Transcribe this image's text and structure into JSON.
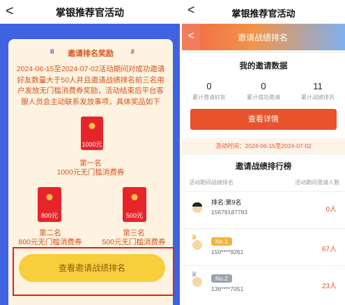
{
  "left": {
    "nav_back": "<",
    "title": "掌银推荐官活动",
    "section_title": "邀请排名奖励",
    "description": "2024-06-15至2024-07-02活动期间对成功邀请好友数量大于50人并且邀请战绩排名前三名用户发放无门槛消费券奖励，活动结束后平台客服人员会主动联系发放事项，具体奖品如下",
    "prizes": [
      {
        "amount": "1000元",
        "rank": "第一名",
        "desc": "1000元无门槛消费券"
      },
      {
        "amount": "800元",
        "rank": "第二名",
        "desc": "800元无门槛消费券"
      },
      {
        "amount": "500元",
        "rank": "第三名",
        "desc": "500元无门槛消费券"
      }
    ],
    "button": "查看邀请战绩排名"
  },
  "right": {
    "nav_back": "<",
    "title": "掌银推荐官活动",
    "header_back": "<",
    "header_title": "邀请战绩排名",
    "data_title": "我的邀请数据",
    "stats": [
      {
        "value": "0",
        "label": "累计邀请好友"
      },
      {
        "value": "0",
        "label": "累计成功邀请"
      },
      {
        "value": "11",
        "label": "累计战绩排名"
      }
    ],
    "details_button": "查看详情",
    "time_label": "活动时间：",
    "time_value": "2024-06-15至2024-07-02",
    "rank_title": "邀请战绩排行榜",
    "col_left": "活动期间战绩排名",
    "col_right": "活动期间邀请人数",
    "rows": [
      {
        "name": "排名:第9名",
        "phone": "15679187783",
        "count": "0人"
      },
      {
        "badge": "No.1",
        "phone": "150****9261",
        "count": "67人"
      },
      {
        "badge": "No.2",
        "phone": "136****7051",
        "count": "23人"
      }
    ],
    "colors": {
      "accent": "#e9532c",
      "badge_gold": "#f4b23c",
      "badge_silver": "#9aa3ad"
    }
  }
}
